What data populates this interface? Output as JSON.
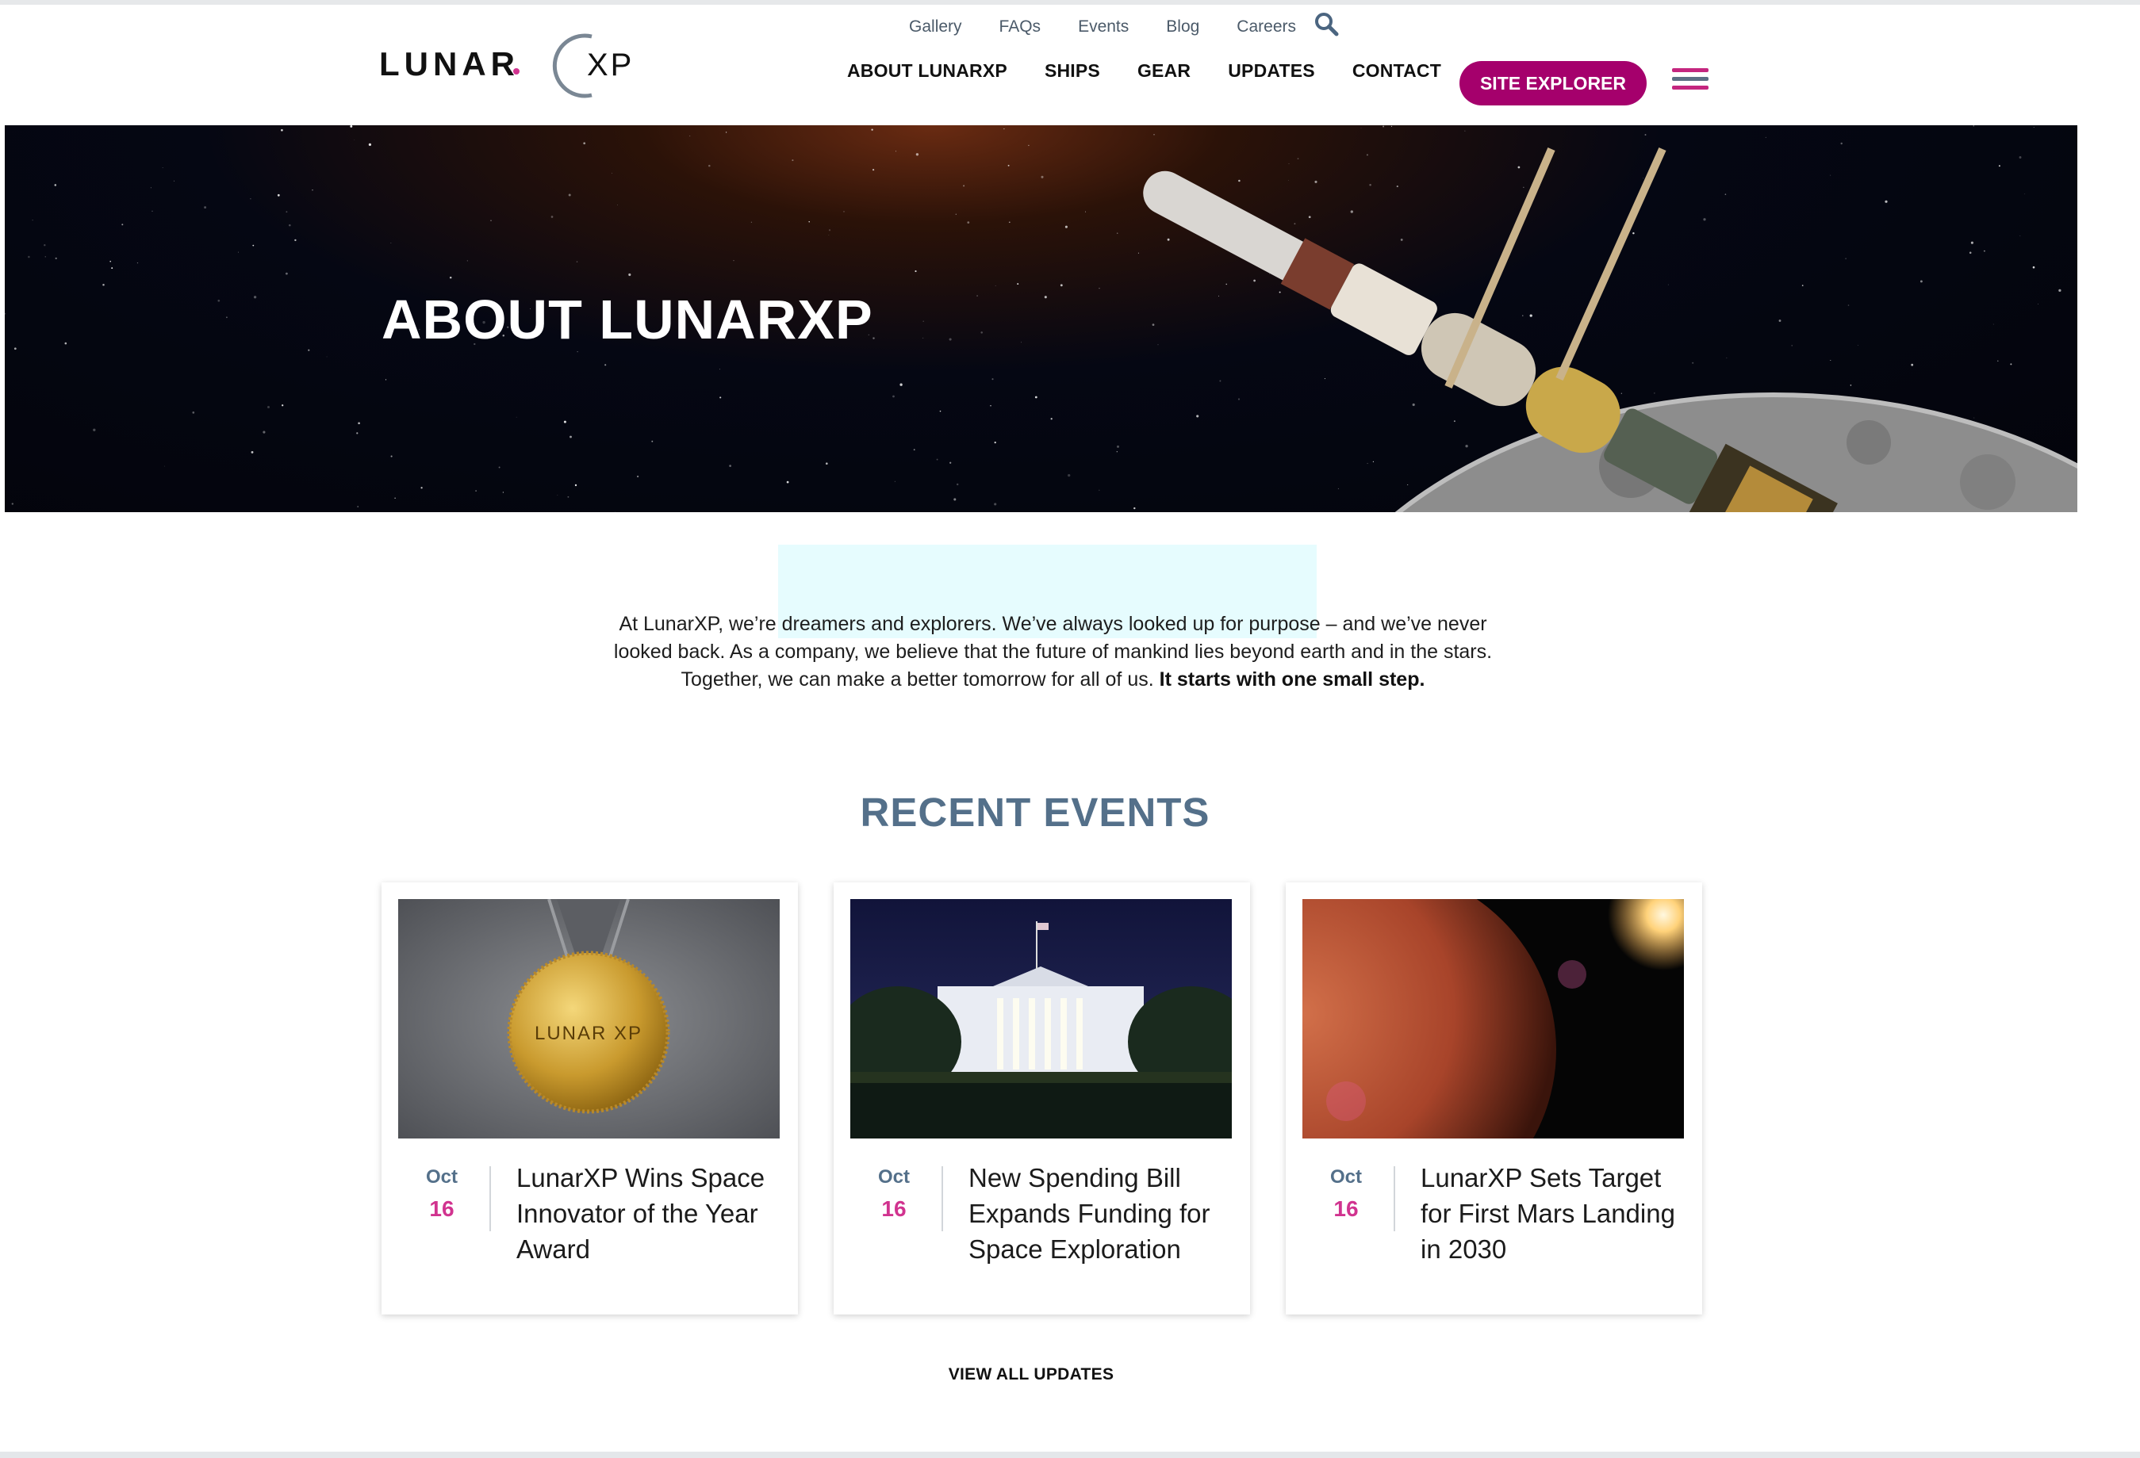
{
  "brand": {
    "name": "LunarXP",
    "logo_text": "LUNAR",
    "logo_suffix": "XP",
    "accent": "#a5006c",
    "pink": "#d1338f",
    "slate": "#54708a"
  },
  "utility_nav": [
    "Gallery",
    "FAQs",
    "Events",
    "Blog",
    "Careers"
  ],
  "main_nav": [
    "ABOUT LUNARXP",
    "SHIPS",
    "GEAR",
    "UPDATES",
    "CONTACT"
  ],
  "cta": {
    "label": "SITE EXPLORER"
  },
  "icons": {
    "search": "search-icon",
    "menu": "hamburger-menu-icon"
  },
  "hero": {
    "title": "ABOUT LUNARXP"
  },
  "intro": {
    "text": "At LunarXP, we’re dreamers and explorers. We’ve always looked up for purpose – and we’ve never looked back. As a company, we believe that the future of mankind lies beyond earth and in the stars. Together, we can make a better tomorrow for all of us. ",
    "emphasis": "It starts with one small step."
  },
  "events": {
    "title": "RECENT EVENTS",
    "items": [
      {
        "month": "Oct",
        "day": "16",
        "title": "LunarXP Wins Space Innovator of the Year Award",
        "image": "gold-medal"
      },
      {
        "month": "Oct",
        "day": "16",
        "title": "New Spending Bill Expands Funding for Space Exploration",
        "image": "white-house-night"
      },
      {
        "month": "Oct",
        "day": "16",
        "title": "LunarXP Sets Target for First Mars Landing in 2030",
        "image": "mars-planet"
      }
    ],
    "view_all": "VIEW ALL UPDATES"
  }
}
